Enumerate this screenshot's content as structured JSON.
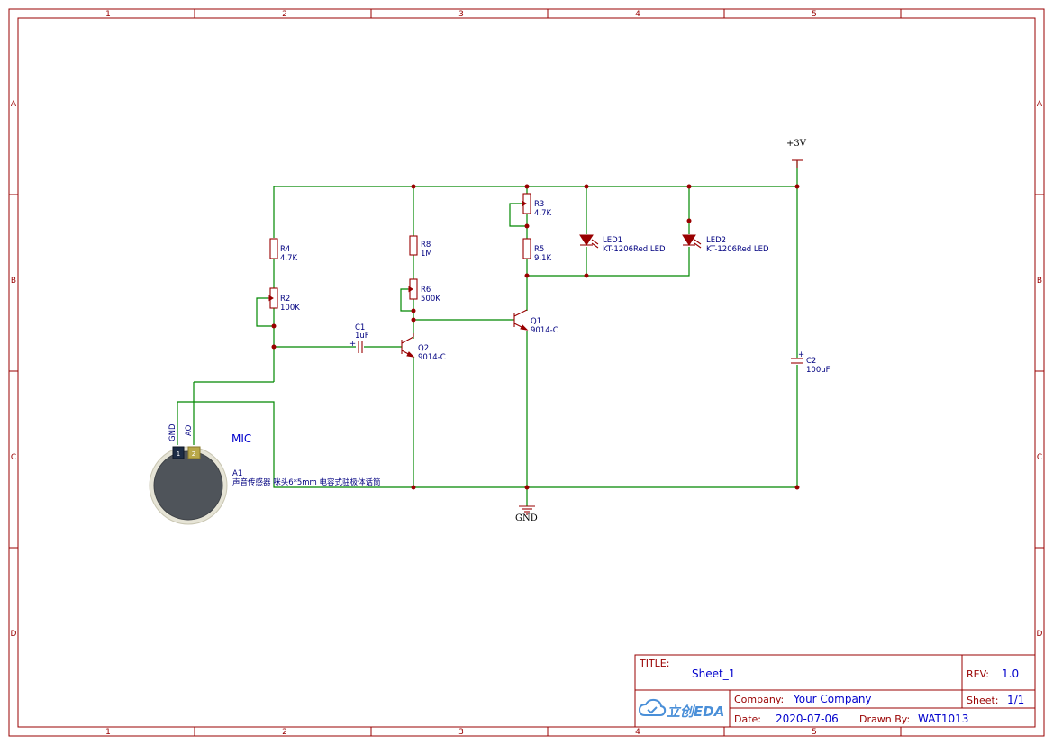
{
  "frame": {
    "columns": [
      "1",
      "2",
      "3",
      "4",
      "5"
    ],
    "rows": [
      "A",
      "B",
      "C",
      "D"
    ],
    "border_color": "#990000",
    "wire_color": "#008800",
    "junction_color": "#990000",
    "label_color": "#000080"
  },
  "nets": {
    "vcc": "+3V",
    "gnd": "GND"
  },
  "components": {
    "R4": {
      "ref": "R4",
      "value": "4.7K"
    },
    "R2": {
      "ref": "R2",
      "value": "100K"
    },
    "R8": {
      "ref": "R8",
      "value": "1M"
    },
    "R6": {
      "ref": "R6",
      "value": "500K"
    },
    "R3": {
      "ref": "R3",
      "value": "4.7K"
    },
    "R5": {
      "ref": "R5",
      "value": "9.1K"
    },
    "C1": {
      "ref": "C1",
      "value": "1uF",
      "polarity": "+"
    },
    "C2": {
      "ref": "C2",
      "value": "100uF",
      "polarity": "+"
    },
    "Q1": {
      "ref": "Q1",
      "value": "9014-C"
    },
    "Q2": {
      "ref": "Q2",
      "value": "9014-C"
    },
    "LED1": {
      "ref": "LED1",
      "value": "KT-1206Red LED"
    },
    "LED2": {
      "ref": "LED2",
      "value": "KT-1206Red LED"
    },
    "A1": {
      "ref": "A1",
      "value": "声音传感器 咪头6*5mm 电容式驻极体话筒",
      "title": "MIC",
      "pin_gnd": "GND",
      "pin_ao": "AO",
      "pin1": "1",
      "pin2": "2"
    }
  },
  "title_block": {
    "title_label": "TITLE:",
    "title": "Sheet_1",
    "rev_label": "REV:",
    "rev": "1.0",
    "company_label": "Company:",
    "company": "Your Company",
    "sheet_label": "Sheet:",
    "sheet": "1/1",
    "date_label": "Date:",
    "date": "2020-07-06",
    "drawn_by_label": "Drawn By:",
    "drawn_by": "WAT1013",
    "logo_text": "立创EDA"
  }
}
